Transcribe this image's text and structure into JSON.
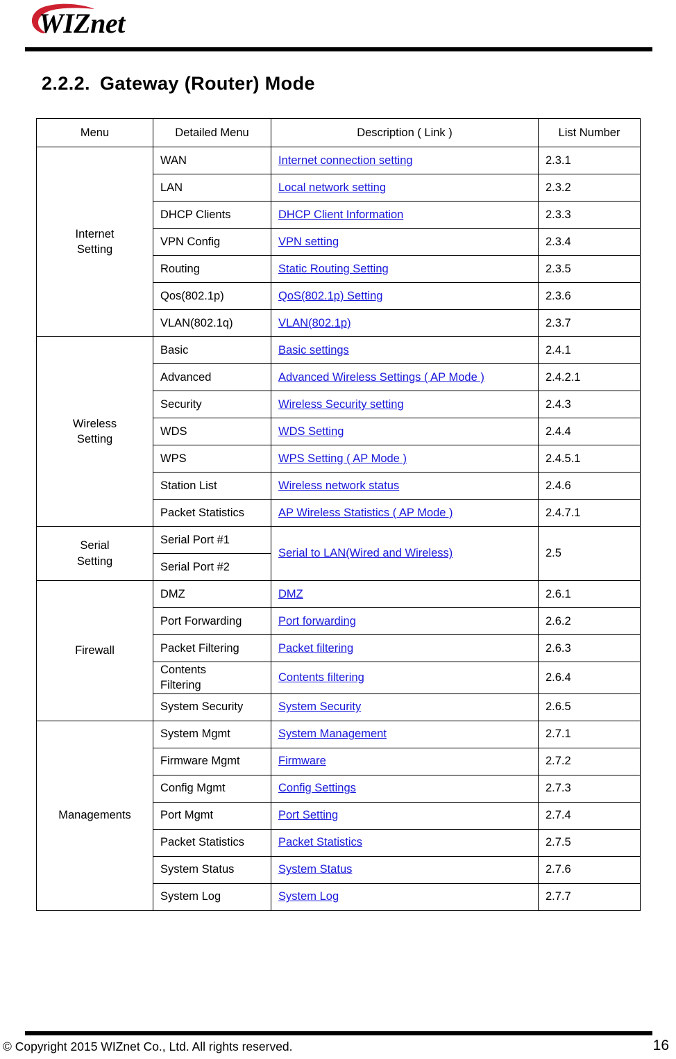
{
  "document": {
    "logo_text": "WIZnet",
    "logo_swoosh_color": "#CE2130",
    "link_color": "#1818DB",
    "section_number": "2.2.2.",
    "section_title": "Gateway  (Router) Mode"
  },
  "table": {
    "headers": [
      "Menu",
      "Detailed Menu",
      "Description ( Link )",
      "List Number"
    ],
    "groups": [
      {
        "menu": "Internet\nSetting",
        "menu_lines": [
          "Internet",
          "Setting"
        ],
        "rows": [
          {
            "detail": "WAN",
            "description": "Internet connection setting",
            "list": "2.3.1"
          },
          {
            "detail": "LAN",
            "description": "Local network setting",
            "list": "2.3.2"
          },
          {
            "detail": "DHCP Clients",
            "description": "DHCP Client Information",
            "list": "2.3.3"
          },
          {
            "detail": "VPN Config",
            "description": "VPN setting",
            "list": "2.3.4"
          },
          {
            "detail": "Routing",
            "description": "Static Routing Setting",
            "list": "2.3.5"
          },
          {
            "detail": "Qos(802.1p)",
            "description": "QoS(802.1p) Setting",
            "list": "2.3.6"
          },
          {
            "detail": "VLAN(802.1q)",
            "description": "VLAN(802.1p)",
            "list": "2.3.7"
          }
        ]
      },
      {
        "menu": "Wireless\nSetting",
        "menu_lines": [
          "Wireless",
          "Setting"
        ],
        "rows": [
          {
            "detail": "Basic",
            "description": "Basic settings",
            "list": "2.4.1"
          },
          {
            "detail": "Advanced",
            "description": "Advanced Wireless Settings ( AP Mode )",
            "list": "2.4.2.1"
          },
          {
            "detail": "Security",
            "description": "Wireless Security setting",
            "list": "2.4.3"
          },
          {
            "detail": "WDS",
            "description": "WDS Setting",
            "list": "2.4.4"
          },
          {
            "detail": "WPS",
            "description": "WPS Setting ( AP Mode )",
            "list": "2.4.5.1"
          },
          {
            "detail": "Station List",
            "description": "Wireless network status",
            "list": "2.4.6"
          },
          {
            "detail": "Packet Statistics",
            "description": "AP Wireless Statistics ( AP Mode )",
            "list": "2.4.7.1"
          }
        ]
      },
      {
        "menu": "Serial\nSetting",
        "menu_lines": [
          "Serial",
          "Setting"
        ],
        "merged_description": "Serial to LAN(Wired and Wireless)",
        "merged_list": "2.5",
        "rows": [
          {
            "detail": "Serial Port #1"
          },
          {
            "detail": "Serial Port #2"
          }
        ]
      },
      {
        "menu": "Firewall",
        "menu_lines": [
          "Firewall"
        ],
        "rows": [
          {
            "detail": "DMZ",
            "description": "DMZ",
            "list": "2.6.1"
          },
          {
            "detail": "Port Forwarding",
            "description": "Port forwarding",
            "list": "2.6.2"
          },
          {
            "detail": "Packet Filtering",
            "description": "Packet filtering",
            "list": "2.6.3"
          },
          {
            "detail": "Contents\nFiltering",
            "detail_lines": [
              "Contents",
              "Filtering"
            ],
            "description": "Contents filtering",
            "list": "2.6.4"
          },
          {
            "detail": "System Security",
            "description": "System Security",
            "list": "2.6.5"
          }
        ]
      },
      {
        "menu": "Managements",
        "menu_lines": [
          "Managements"
        ],
        "rows": [
          {
            "detail": "System Mgmt",
            "description": "System Management",
            "list": "2.7.1"
          },
          {
            "detail": "Firmware Mgmt",
            "description": "Firmware",
            "list": "2.7.2"
          },
          {
            "detail": "Config Mgmt",
            "description": "Config Settings",
            "list": "2.7.3"
          },
          {
            "detail": "Port Mgmt",
            "description": "Port Setting",
            "list": "2.7.4"
          },
          {
            "detail": "Packet Statistics",
            "description": "Packet Statistics",
            "list": "2.7.5"
          },
          {
            "detail": "System Status",
            "description": "System Status",
            "list": "2.7.6"
          },
          {
            "detail": "System Log",
            "description": "System Log",
            "list": "2.7.7"
          }
        ]
      }
    ]
  },
  "footer": {
    "copyright": "© Copyright 2015 WIZnet Co., Ltd. All rights reserved.",
    "page_number": "16"
  }
}
